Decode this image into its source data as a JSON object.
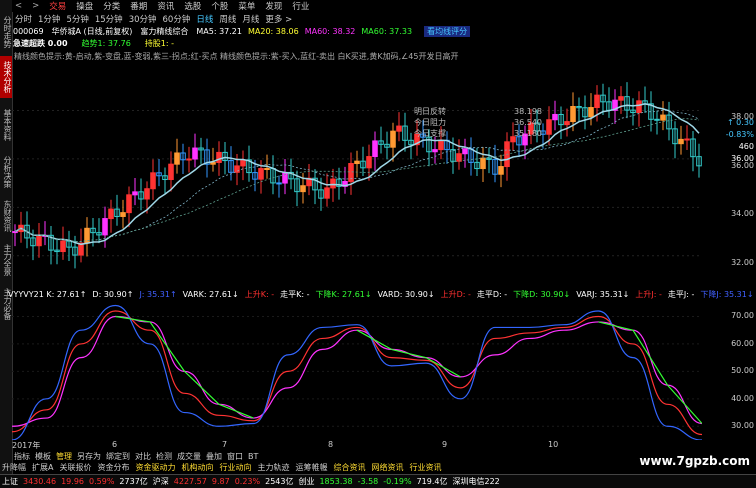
{
  "sidebar": {
    "tabs": [
      "分时走势",
      "技术分析",
      "基本资料",
      "分析决策",
      "东财资讯",
      "主力全景",
      "主力必备"
    ],
    "active_index": 1
  },
  "menubar": {
    "items": [
      "交易",
      "操盘",
      "分类",
      "番期",
      "资讯",
      "选股",
      "个股",
      "菜单",
      "发现",
      "行业"
    ],
    "active_index": 0
  },
  "period": {
    "items": [
      "分时",
      "1分钟",
      "5分钟",
      "15分钟",
      "30分钟",
      "60分钟",
      "日线",
      "周线",
      "月线",
      "更多 >"
    ],
    "active_index": 6
  },
  "kinfo": {
    "code": "000069",
    "name": "华侨城A (日线,前复权)",
    "indicator": "富力精线综合",
    "ma": [
      {
        "label": "MA5:",
        "value": "37.21",
        "color": "#ffffff"
      },
      {
        "label": "MA20:",
        "value": "38.06",
        "color": "#ffff33"
      },
      {
        "label": "MA60:",
        "value": "38.32",
        "color": "#ff33ff"
      },
      {
        "label": "MA60:",
        "value": "37.33",
        "color": "#33ff33"
      }
    ],
    "tag": "看均线评分"
  },
  "kinfo2": {
    "label": "急速超跌",
    "value": "0.00",
    "trend_label": "趋势1:",
    "trend_value": "37.76",
    "hold_label": "持股1:",
    "hold_value": "-"
  },
  "hint": "精线颜色提示:黄-启动,紫-变盘,蓝-变弱,紫三-拐点;红-买点  精线颜色提示:紫-买入,蓝红-卖出 白K买进,黄K加码,∠45开发日高开",
  "mainchart": {
    "annotation": [
      "明日反转",
      "今日阻力",
      "今日支撑"
    ],
    "annotation_values": [
      "38.198",
      "36.540",
      "35.180"
    ],
    "price_labels": [
      "38.00",
      "36.00",
      "34.00",
      "32.00"
    ],
    "right_info": [
      {
        "text": "↑ 0.30",
        "color": "#46c8ff"
      },
      {
        "text": "-0.83%",
        "color": "#46c8ff"
      },
      {
        "text": "460",
        "color": "#ffffff"
      },
      {
        "text": "36.00",
        "color": "#ffffff"
      }
    ]
  },
  "kdjhdr": {
    "items": [
      {
        "text": "VYYVY21 K: 27.61↑",
        "color": "#ffffff"
      },
      {
        "text": "D: 30.90↑",
        "color": "#ffffff"
      },
      {
        "text": "J: 35.31↑",
        "color": "#4060ff"
      },
      {
        "text": "VARK: 27.61↓",
        "color": "#ffffff"
      },
      {
        "text": "上升K: -",
        "color": "#ff3030"
      },
      {
        "text": "走平K: -",
        "color": "#ffffff"
      },
      {
        "text": "下降K: 27.61↓",
        "color": "#33ff33"
      },
      {
        "text": "VARD: 30.90↓",
        "color": "#ffffff"
      },
      {
        "text": "上升D: -",
        "color": "#ff3030"
      },
      {
        "text": "走平D: -",
        "color": "#ffffff"
      },
      {
        "text": "下降D: 30.90↓",
        "color": "#33ff33"
      },
      {
        "text": "VARJ: 35.31↓",
        "color": "#ffffff"
      },
      {
        "text": "上升J: -",
        "color": "#ff3030"
      },
      {
        "text": "走平J: -",
        "color": "#ffffff"
      },
      {
        "text": "下降J: 35.31↓",
        "color": "#4060ff"
      }
    ]
  },
  "kdj_axis": [
    "70.00",
    "60.00",
    "50.00",
    "40.00",
    "30.00"
  ],
  "dates": [
    "2017年",
    "6",
    "7",
    "8",
    "9",
    "10"
  ],
  "tabs1": [
    "指标",
    "模板",
    "管理",
    "另存为",
    "绑定到",
    "对比",
    "检测",
    "成交量",
    "叠加",
    "窗口",
    "BT"
  ],
  "tabs1_active": 2,
  "tabs2": [
    {
      "text": "升降幅",
      "hl": false
    },
    {
      "text": "扩展A",
      "hl": false
    },
    {
      "text": "关联报价",
      "hl": false
    },
    {
      "text": "资金分布",
      "hl": false
    },
    {
      "text": "资金驱动力",
      "hl": true
    },
    {
      "text": "机构动向",
      "hl": true
    },
    {
      "text": "行业动向",
      "hl": true
    },
    {
      "text": "主力轨迹",
      "hl": false
    },
    {
      "text": "运筹帷幄",
      "hl": false
    },
    {
      "text": "综合资讯",
      "hl": true
    },
    {
      "text": "网络资讯",
      "hl": true
    },
    {
      "text": "行业资讯",
      "hl": true
    }
  ],
  "statusbar": [
    {
      "text": "上证",
      "color": "#ffffff"
    },
    {
      "text": "3430.46",
      "color": "#ff3030"
    },
    {
      "text": "19.96",
      "color": "#ff3030"
    },
    {
      "text": "0.59%",
      "color": "#ff3030"
    },
    {
      "text": "2737亿",
      "color": "#ffffff"
    },
    {
      "text": "沪深",
      "color": "#ffffff"
    },
    {
      "text": "4227.57",
      "color": "#ff3030"
    },
    {
      "text": "9.87",
      "color": "#ff3030"
    },
    {
      "text": "0.23%",
      "color": "#ff3030"
    },
    {
      "text": "2543亿",
      "color": "#ffffff"
    },
    {
      "text": "创业",
      "color": "#ffffff"
    },
    {
      "text": "1853.38",
      "color": "#33ff33"
    },
    {
      "text": "-3.58",
      "color": "#33ff33"
    },
    {
      "text": "-0.19%",
      "color": "#33ff33"
    },
    {
      "text": "719.4亿",
      "color": "#ffffff"
    },
    {
      "text": "深圳电信222",
      "color": "#ffffff"
    }
  ],
  "watermark": "www.7gpzb.com",
  "chart_data": {
    "type": "line",
    "categories": [
      "2017年",
      "6",
      "7",
      "8",
      "9",
      "10"
    ],
    "series": [
      {
        "name": "K",
        "values": [
          28,
          36,
          60,
          72,
          65,
          42,
          34,
          32,
          50,
          62,
          66,
          55,
          54,
          44,
          62,
          64,
          66,
          70,
          60,
          38,
          27
        ]
      },
      {
        "name": "D",
        "values": [
          30,
          33,
          55,
          70,
          68,
          50,
          38,
          33,
          44,
          58,
          65,
          58,
          55,
          48,
          56,
          62,
          65,
          68,
          65,
          45,
          31
        ]
      },
      {
        "name": "J",
        "values": [
          25,
          40,
          65,
          74,
          60,
          35,
          30,
          31,
          56,
          66,
          67,
          52,
          53,
          40,
          66,
          66,
          67,
          72,
          55,
          30,
          25
        ]
      }
    ],
    "ylim": [
      25,
      76
    ]
  }
}
